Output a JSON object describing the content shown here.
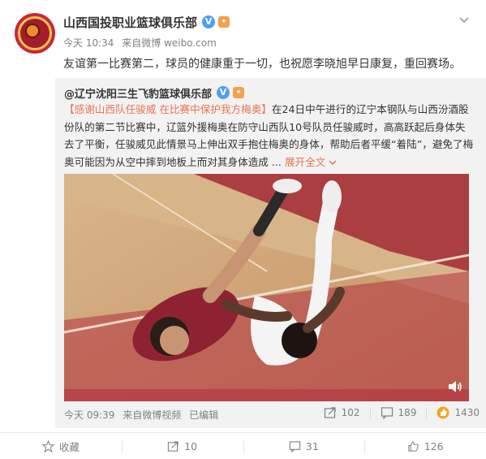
{
  "post": {
    "author": "山西国投职业篮球俱乐部",
    "verified_badge": "V",
    "time": "今天 10:34",
    "source_prefix": "来自",
    "source": "微博 weibo.com",
    "text": "友谊第一比赛第二，球员的健康重于一切，也祝愿李晓旭早日康复，重回赛场。"
  },
  "repost": {
    "author": "@辽宁沈阳三生飞豹篮球俱乐部",
    "verified_badge": "V",
    "topic": "【感谢山西队任骏威 在比赛中保护我方梅奥】",
    "body": "在24日中午进行的辽宁本钢队与山西汾酒股份队的第二节比赛中，辽篮外援梅奥在防守山西队10号队员任骏威时，高高跃起后身体失去了平衡，任骏威见此情景马上伸出双手抱住梅奥的身体，帮助后者平缓“着陆”，避免了梅奥可能因为从空中摔到地板上而对其身体造成 ...",
    "expand": "展开全文",
    "expand_icon": "chevron-down-icon",
    "time": "今天 09:39",
    "source_prefix": "来自",
    "source": "微博视频",
    "edited": "已编辑",
    "reposts": "102",
    "comments": "189",
    "likes": "1430"
  },
  "footer": {
    "favorite": "收藏",
    "forward": "10",
    "comment": "31",
    "like": "126"
  },
  "colors": {
    "accent": "#eb7350",
    "verified": "#4d9ff5",
    "muted": "#808080"
  }
}
